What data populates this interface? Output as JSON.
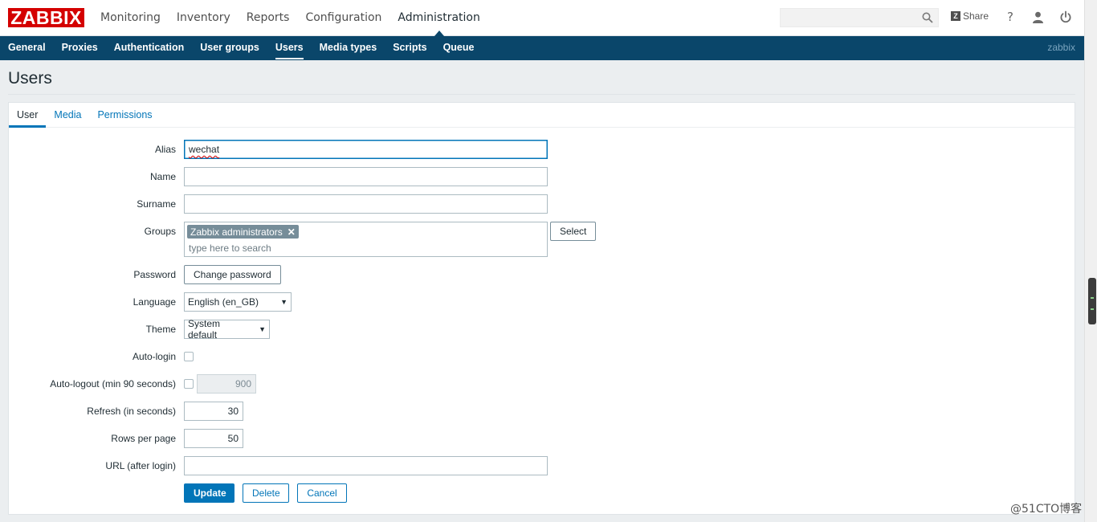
{
  "app": {
    "logo_text": "ZABBIX",
    "brand_color": "#d40000"
  },
  "main_nav": [
    {
      "label": "Monitoring"
    },
    {
      "label": "Inventory"
    },
    {
      "label": "Reports"
    },
    {
      "label": "Configuration"
    },
    {
      "label": "Administration",
      "active": true
    }
  ],
  "header_tools": {
    "search_value": "",
    "share_label": "Share",
    "help_label": "?"
  },
  "sub_nav": [
    {
      "label": "General"
    },
    {
      "label": "Proxies"
    },
    {
      "label": "Authentication"
    },
    {
      "label": "User groups"
    },
    {
      "label": "Users",
      "active": true
    },
    {
      "label": "Media types"
    },
    {
      "label": "Scripts"
    },
    {
      "label": "Queue"
    }
  ],
  "current_user": "zabbix",
  "page": {
    "title": "Users"
  },
  "tabs": [
    {
      "label": "User",
      "active": true
    },
    {
      "label": "Media"
    },
    {
      "label": "Permissions"
    }
  ],
  "form": {
    "alias": {
      "label": "Alias",
      "value": "wechat"
    },
    "name": {
      "label": "Name",
      "value": ""
    },
    "surname": {
      "label": "Surname",
      "value": ""
    },
    "groups": {
      "label": "Groups",
      "chips": [
        "Zabbix administrators"
      ],
      "placeholder": "type here to search",
      "select_label": "Select"
    },
    "password": {
      "label": "Password",
      "button_label": "Change password"
    },
    "language": {
      "label": "Language",
      "selected": "English (en_GB)"
    },
    "theme": {
      "label": "Theme",
      "selected": "System default"
    },
    "autologin": {
      "label": "Auto-login",
      "checked": false
    },
    "autologout": {
      "label": "Auto-logout (min 90 seconds)",
      "checked": false,
      "value": "900"
    },
    "refresh": {
      "label": "Refresh (in seconds)",
      "value": "30"
    },
    "rows_per_page": {
      "label": "Rows per page",
      "value": "50"
    },
    "url": {
      "label": "URL (after login)",
      "value": ""
    },
    "buttons": {
      "update": "Update",
      "delete": "Delete",
      "cancel": "Cancel"
    }
  },
  "watermark": "@51CTO博客",
  "icons": {
    "search": "search-icon",
    "share": "zabbix-share-icon",
    "help": "help-icon",
    "user": "user-profile-icon",
    "signout": "power-icon"
  }
}
